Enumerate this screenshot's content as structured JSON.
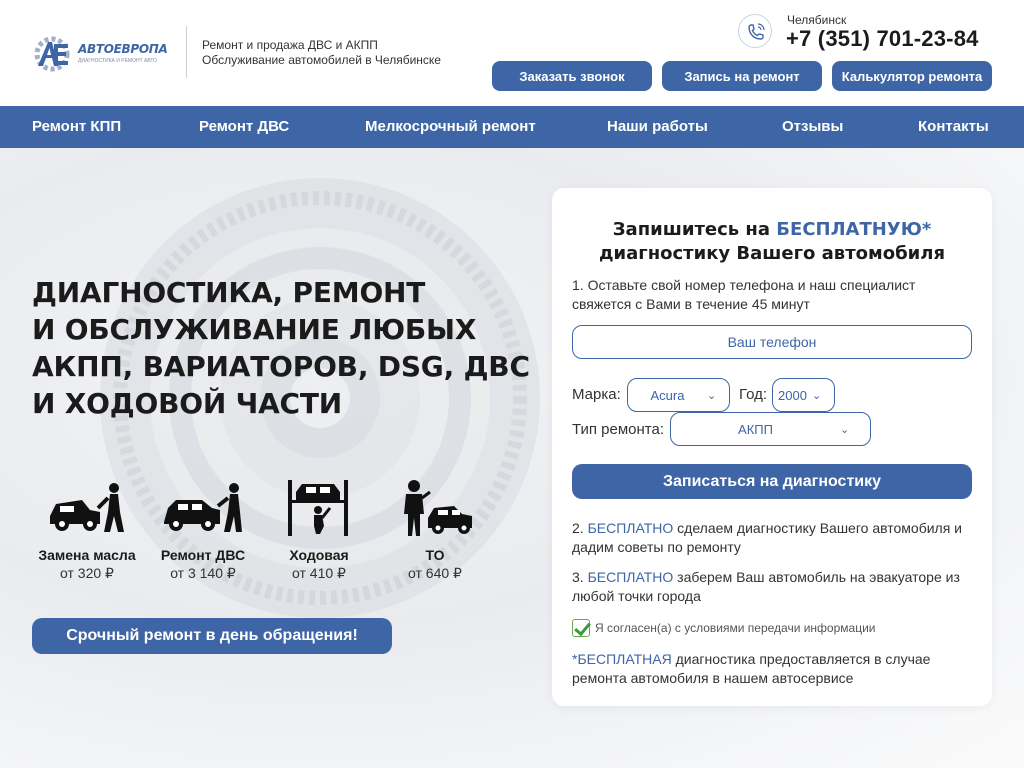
{
  "header": {
    "logo": {
      "name": "АВТОЕВРОПА",
      "sub": "ДИАГНОСТИКА И РЕМОНТ АВТО",
      "mark": "AE"
    },
    "tagline": [
      "Ремонт и продажа ДВС и АКПП",
      "Обслуживание автомобилей в Челябинске"
    ],
    "city": "Челябинск",
    "phone": "+7 (351) 701-23-84",
    "buttons": {
      "callback": "Заказать звонок",
      "booking": "Запись на ремонт",
      "calculator": "Калькулятор ремонта"
    }
  },
  "nav": {
    "items": [
      "Ремонт КПП",
      "Ремонт ДВС",
      "Мелкосрочный ремонт",
      "Наши работы",
      "Отзывы",
      "Контакты"
    ]
  },
  "hero": {
    "headline": [
      "ДИАГНОСТИКА, РЕМОНТ",
      "И ОБСЛУЖИВАНИЕ ЛЮБЫХ",
      "АКПП, ВАРИАТОРОВ, DSG, ДВС",
      "И ХОДОВОЙ ЧАСТИ"
    ],
    "services": [
      {
        "name": "Замена масла",
        "price": "от 320 ₽",
        "icon": "oil-change-icon"
      },
      {
        "name": "Ремонт ДВС",
        "price": "от 3 140 ₽",
        "icon": "engine-repair-icon"
      },
      {
        "name": "Ходовая",
        "price": "от 410 ₽",
        "icon": "car-lift-icon"
      },
      {
        "name": "ТО",
        "price": "от 640 ₽",
        "icon": "maintenance-icon"
      }
    ],
    "urgent_button": "Срочный ремонт в день обращения!"
  },
  "form": {
    "title_pre": "Запишитесь на ",
    "title_accent": "БЕСПЛАТНУЮ*",
    "title_line2": "диагностику Вашего автомобиля",
    "step1": "1. Оставьте свой номер телефона и наш специалист свяжется с Вами в течение 45 минут",
    "phone_placeholder": "Ваш телефон",
    "brand_label": "Марка:",
    "brand_value": "Acura",
    "year_label": "Год:",
    "year_value": "2000",
    "repair_type_label": "Тип ремонта:",
    "repair_type_value": "АКПП",
    "submit": "Записаться на диагностику",
    "step2_num": "2. ",
    "step2_accent": "БЕСПЛАТНО",
    "step2_text": " сделаем диагностику Вашего автомобиля и дадим советы по ремонту",
    "step3_num": "3. ",
    "step3_accent": "БЕСПЛАТНО",
    "step3_text": " заберем Ваш автомобиль на эвакуаторе из любой точки города",
    "consent": "Я согласен(а) с условиями передачи информации",
    "consent_checked": true,
    "note_star": "*",
    "note_accent": "БЕСПЛАТНАЯ",
    "note_text": " диагностика предоставляется в случае ремонта автомобиля в нашем автосервисе"
  },
  "colors": {
    "accent": "#3e66a6",
    "check": "#3d9a3a"
  }
}
